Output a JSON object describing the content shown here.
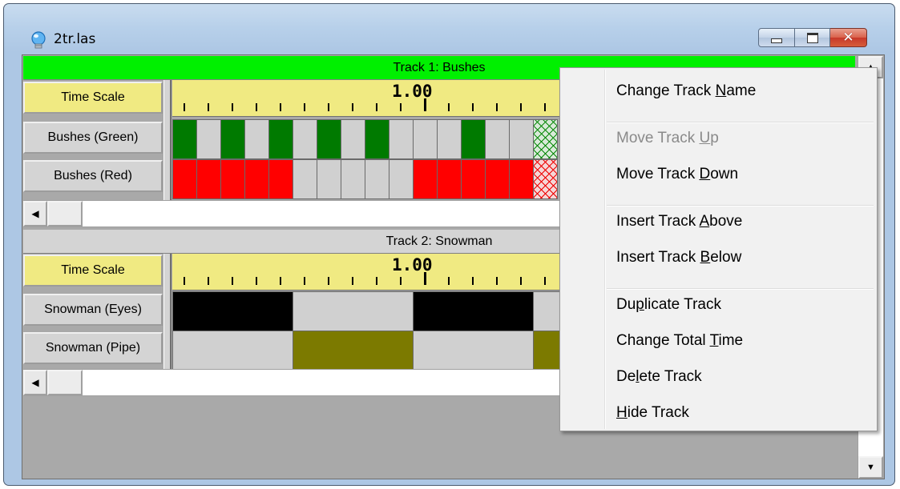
{
  "window": {
    "title": "2tr.las"
  },
  "tracks": [
    {
      "header": "Track 1: Bushes",
      "header_color": "#00f000",
      "timescale_label": "Time Scale",
      "timescale_value": "1.00",
      "rows": [
        {
          "label": "Bushes (Green)",
          "cells": [
            "green",
            "off",
            "green",
            "off",
            "green",
            "off",
            "green",
            "off",
            "green",
            "off",
            "off",
            "off",
            "green",
            "off",
            "off",
            "hatch-green"
          ]
        },
        {
          "label": "Bushes (Red)",
          "cells": [
            "red",
            "red",
            "red",
            "red",
            "red",
            "off",
            "off",
            "off",
            "off",
            "off",
            "red",
            "red",
            "red",
            "red",
            "red",
            "hatch-red"
          ]
        }
      ]
    },
    {
      "header": "Track 2: Snowman",
      "header_color": "#d4d4d4",
      "timescale_label": "Time Scale",
      "timescale_value": "1.00",
      "rows": [
        {
          "label": "Snowman (Eyes)",
          "cells": [
            "black",
            "off",
            "black",
            "off"
          ]
        },
        {
          "label": "Snowman (Pipe)",
          "cells": [
            "off",
            "olive",
            "off",
            "olive"
          ]
        }
      ]
    }
  ],
  "context_menu": {
    "items": [
      {
        "pre": "Change Track ",
        "key": "N",
        "post": "ame",
        "enabled": true
      },
      {
        "separator": true
      },
      {
        "pre": "Move Track ",
        "key": "U",
        "post": "p",
        "enabled": false
      },
      {
        "pre": "Move Track ",
        "key": "D",
        "post": "own",
        "enabled": true
      },
      {
        "separator": true
      },
      {
        "pre": "Insert Track ",
        "key": "A",
        "post": "bove",
        "enabled": true
      },
      {
        "pre": "Insert Track ",
        "key": "B",
        "post": "elow",
        "enabled": true
      },
      {
        "separator": true
      },
      {
        "pre": "Du",
        "key": "p",
        "post": "licate Track",
        "enabled": true
      },
      {
        "pre": "Change Total ",
        "key": "T",
        "post": "ime",
        "enabled": true
      },
      {
        "pre": "De",
        "key": "l",
        "post": "ete Track",
        "enabled": true
      },
      {
        "pre": "",
        "key": "H",
        "post": "ide Track",
        "enabled": true
      }
    ]
  },
  "icons": {
    "app": "lightbulb-icon",
    "minimize": "minimize-icon",
    "maximize": "maximize-icon",
    "close": "close-icon",
    "scroll_left": "arrow-left-icon",
    "scroll_up": "arrow-up-icon",
    "scroll_down": "arrow-down-icon"
  },
  "colors": {
    "timescale": "#f0ea82",
    "on_green": "#007a00",
    "on_red": "#ff0000",
    "on_black": "#000000",
    "on_olive": "#7c7a00",
    "off": "#d0d0d0"
  }
}
